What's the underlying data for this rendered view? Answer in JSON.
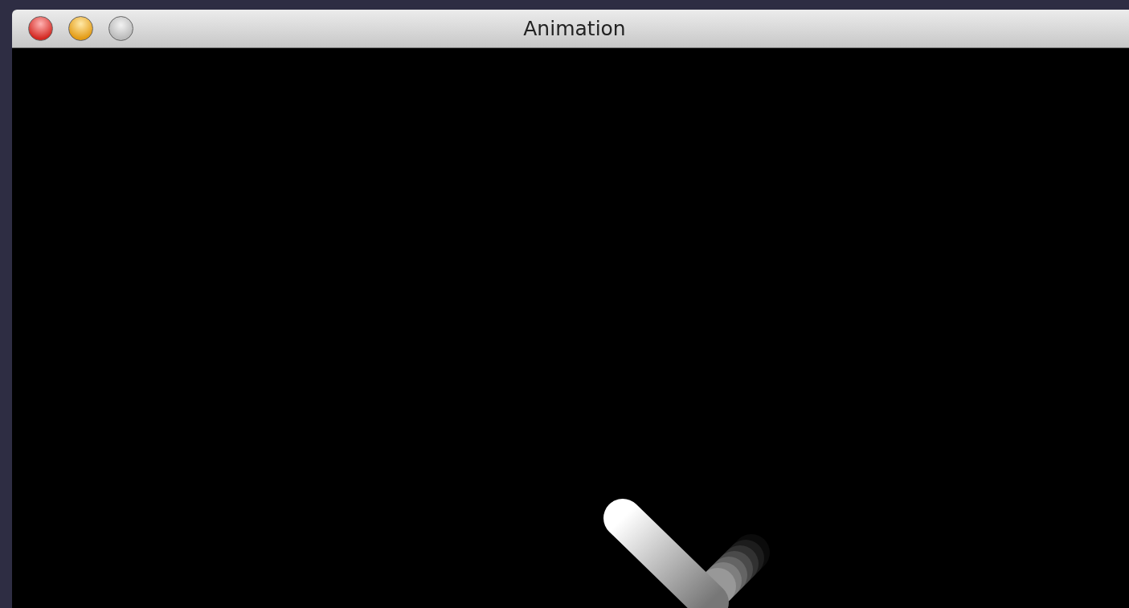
{
  "window": {
    "title": "Animation",
    "buttons": [
      {
        "kind": "close",
        "disabled": false
      },
      {
        "kind": "minimize",
        "disabled": false
      },
      {
        "kind": "zoom",
        "disabled": true
      }
    ]
  }
}
